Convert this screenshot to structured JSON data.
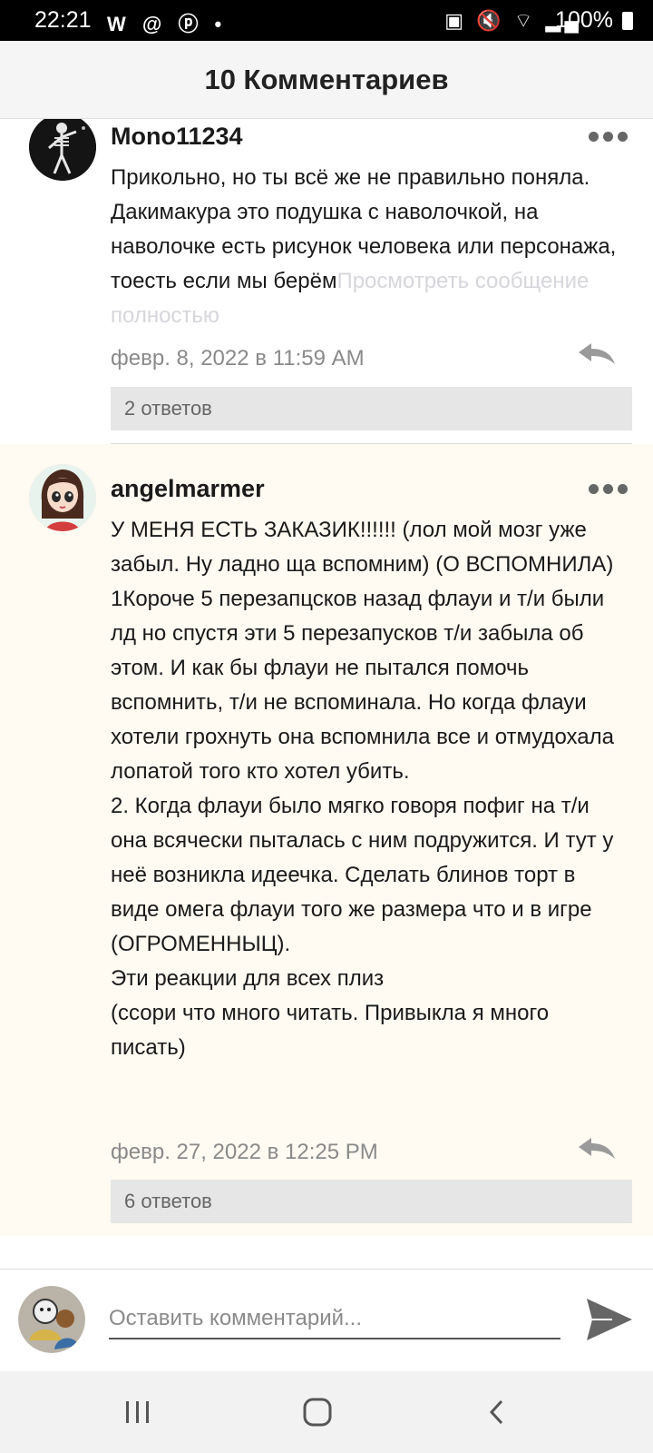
{
  "status_bar": {
    "time": "22:21",
    "notification_icons": "W @ ⓟ •",
    "system_icons": "▣ 🔇 ⌔ ▂▄",
    "battery": "100%"
  },
  "header": {
    "title": "10 Комментариев"
  },
  "comments": [
    {
      "username": "Mono11234",
      "text": "Прикольно, но ты всё же не правильно поняла. Дакимакура это подушка с наволочкой, на наволочке есть рисунок человека или персонажа, тоесть если мы берём",
      "more_link": "Просмотреть сообщение полностью",
      "date": "февр. 8, 2022 в 11:59 AM",
      "replies": "2 ответов",
      "avatar_icon": "skeleton-avatar"
    },
    {
      "username": "angelmarmer",
      "text": "У МЕНЯ ЕСТЬ ЗАКАЗИК!!!!!! (лол мой мозг уже забыл. Ну ладно ща вспомним) (О ВСПОМНИЛА)\n1Короче 5 перезапцсков назад флауи и т/и были лд но спустя эти 5 перезапусков т/и забыла об этом. И как бы флауи не пытался помочь вспомнить, т/и не вспоминала. Но когда флауи хотели грохнуть она вспомнила все и отмудохала лопатой того кто хотел убить.\n2. Когда флауи было мягко говоря пофиг на т/и она всячески пыталась с ним подружится. И тут у неё возникла идеечка. Сделать блинов торт в виде омега флауи того же размера что и в игре (ОГРОМЕННЫЦ).\nЭти реакции для всех плиз\n(ссори что много читать. Привыкла я много писать)",
      "date": "февр. 27, 2022 в 12:25 PM",
      "replies": "6 ответов",
      "avatar_icon": "girl-avatar"
    }
  ],
  "composer": {
    "placeholder": "Оставить комментарий..."
  },
  "colors": {
    "highlight_bg": "#fffaf2",
    "replies_bg": "#e6e6e6",
    "muted_text": "#8a8a8a"
  }
}
